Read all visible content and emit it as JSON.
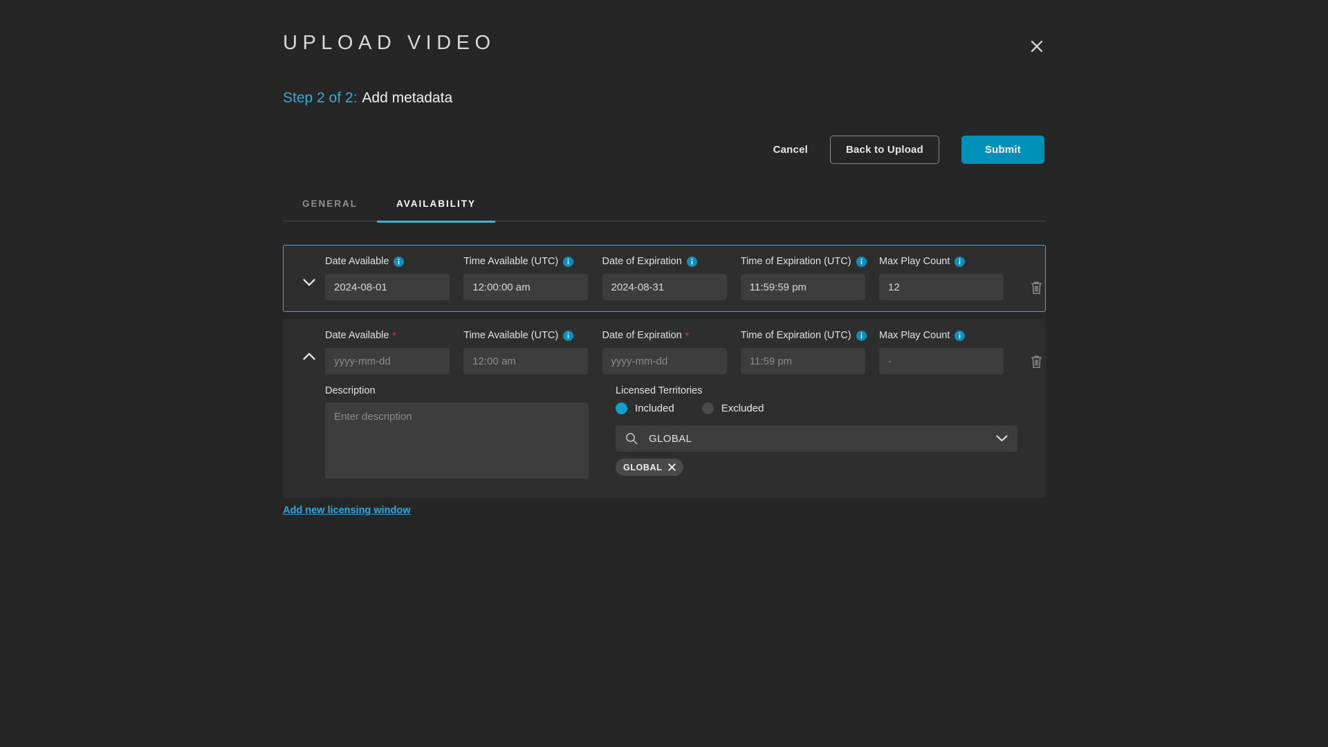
{
  "modal": {
    "title": "UPLOAD VIDEO",
    "close_icon": "close-icon",
    "step_label": "Step 2 of 2:",
    "step_title": "Add metadata"
  },
  "actions": {
    "cancel_label": "Cancel",
    "back_label": "Back to Upload",
    "submit_label": "Submit"
  },
  "tabs": [
    {
      "label": "GENERAL",
      "active": false
    },
    {
      "label": "AVAILABILITY",
      "active": true
    }
  ],
  "field_labels": {
    "date_available": "Date Available",
    "time_available": "Time Available (UTC)",
    "date_expiration": "Date of Expiration",
    "time_expiration": "Time of Expiration (UTC)",
    "max_play_count": "Max Play Count",
    "description": "Description",
    "licensed_territories": "Licensed Territories"
  },
  "windows": [
    {
      "selected": true,
      "expanded": false,
      "toggle_icon": "chevron-down-icon",
      "date_available": {
        "value": "2024-08-01",
        "placeholder": "yyyy-mm-dd",
        "required": false,
        "has_info": true
      },
      "time_available": {
        "value": "12:00:00 am",
        "placeholder": "12:00 am",
        "required": false,
        "has_info": true
      },
      "date_expiration": {
        "value": "2024-08-31",
        "placeholder": "yyyy-mm-dd",
        "required": false,
        "has_info": true
      },
      "time_expiration": {
        "value": "11:59:59 pm",
        "placeholder": "11:59 pm",
        "required": false,
        "has_info": true
      },
      "max_play_count": {
        "value": "12",
        "placeholder": "-",
        "required": false,
        "has_info": true
      }
    },
    {
      "selected": false,
      "expanded": true,
      "toggle_icon": "chevron-up-icon",
      "date_available": {
        "value": "",
        "placeholder": "yyyy-mm-dd",
        "required": true,
        "has_info": false
      },
      "time_available": {
        "value": "",
        "placeholder": "12:00 am",
        "required": false,
        "has_info": true
      },
      "date_expiration": {
        "value": "",
        "placeholder": "yyyy-mm-dd",
        "required": true,
        "has_info": false
      },
      "time_expiration": {
        "value": "",
        "placeholder": "11:59 pm",
        "required": false,
        "has_info": true
      },
      "max_play_count": {
        "value": "",
        "placeholder": "-",
        "required": false,
        "has_info": true
      },
      "description": {
        "value": "",
        "placeholder": "Enter description"
      },
      "territories": {
        "mode_included_label": "Included",
        "mode_excluded_label": "Excluded",
        "selected_mode": "Included",
        "select_value": "GLOBAL",
        "search_icon": "search-icon",
        "dropdown_icon": "chevron-down-icon",
        "chips": [
          {
            "label": "GLOBAL",
            "remove_icon": "close-icon"
          }
        ]
      }
    }
  ],
  "add_link_label": "Add new licensing window",
  "colors": {
    "background": "#262626",
    "panel": "#2e2e2e",
    "input": "#3d3d3d",
    "accent": "#29b6e8",
    "submit": "#0090b8",
    "link": "#2fa8dd",
    "required": "#e23b3b",
    "info_icon": "#0f8fba"
  }
}
